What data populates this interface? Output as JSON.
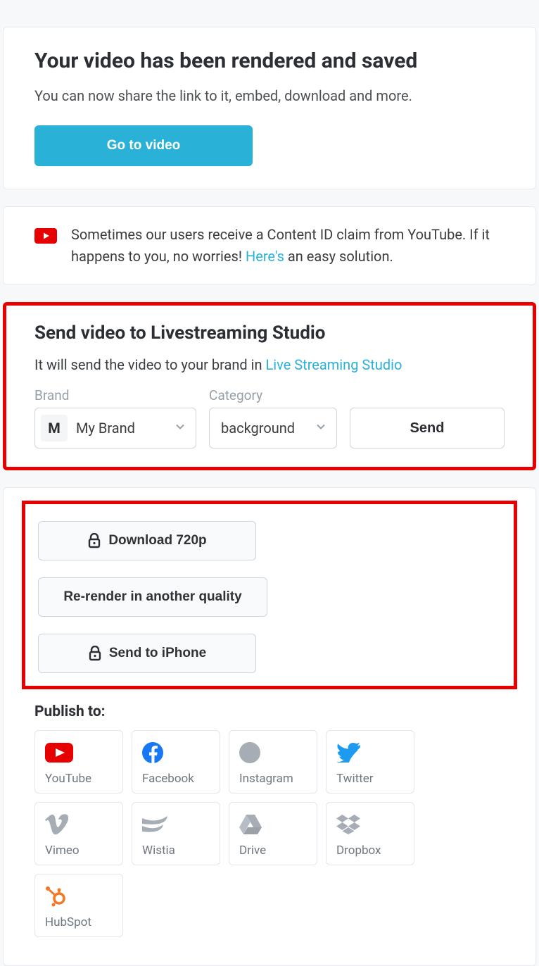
{
  "hero": {
    "title": "Your video has been rendered and saved",
    "subtitle": "You can now share the link to it, embed, download and more.",
    "cta": "Go to video"
  },
  "notice": {
    "text_before": "Sometimes our users receive a Content ID claim from YouTube. If it happens to you, no worries! ",
    "link": "Here's",
    "text_after": " an easy solution."
  },
  "livestream": {
    "title": "Send video to Livestreaming Studio",
    "desc_before": "It will send the video to your brand in ",
    "desc_link": "Live Streaming Studio",
    "brand_label": "Brand",
    "brand_initial": "M",
    "brand_value": "My Brand",
    "category_label": "Category",
    "category_value": "background",
    "send_label": "Send"
  },
  "actions": {
    "download": "Download 720p",
    "rerender": "Re-render in another quality",
    "send_iphone": "Send to iPhone"
  },
  "publish": {
    "label": "Publish to:",
    "targets": [
      {
        "name": "YouTube"
      },
      {
        "name": "Facebook"
      },
      {
        "name": "Instagram"
      },
      {
        "name": "Twitter"
      },
      {
        "name": "Vimeo"
      },
      {
        "name": "Wistia"
      },
      {
        "name": "Drive"
      },
      {
        "name": "Dropbox"
      },
      {
        "name": "HubSpot"
      }
    ]
  }
}
